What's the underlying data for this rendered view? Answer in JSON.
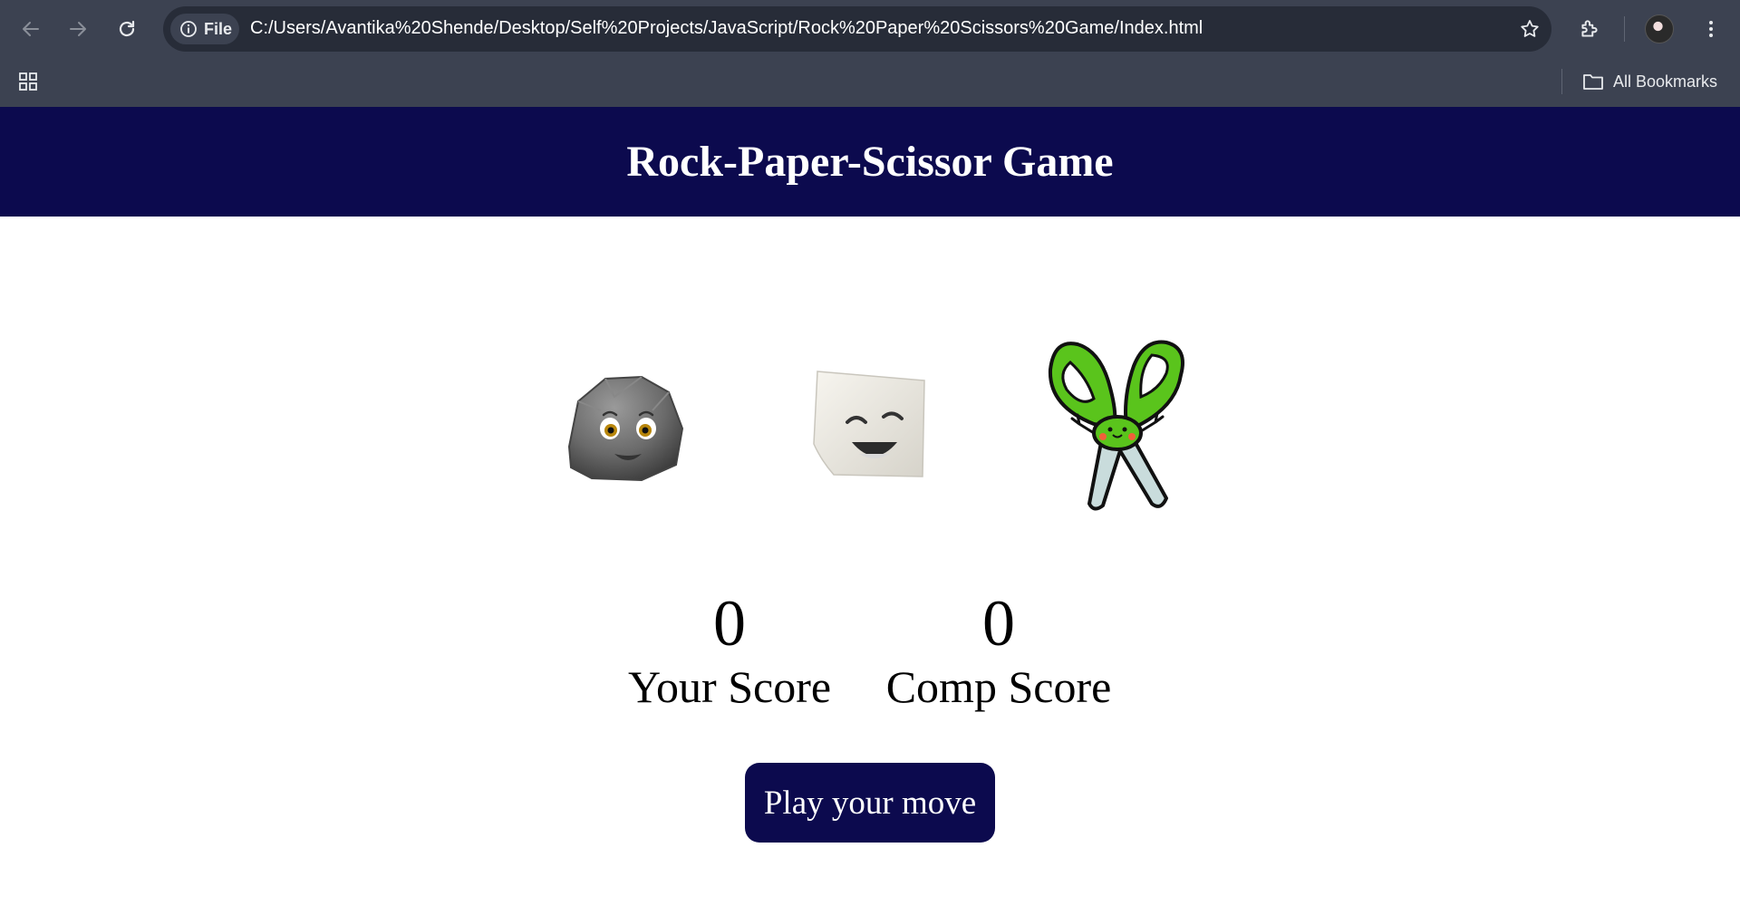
{
  "browser": {
    "site_chip": "File",
    "url": "C:/Users/Avantika%20Shende/Desktop/Self%20Projects/JavaScript/Rock%20Paper%20Scissors%20Game/Index.html",
    "bookmarks_label": "All Bookmarks",
    "chrome_color": "#3c4251",
    "omnibox_color": "#272c38"
  },
  "page": {
    "title": "Rock-Paper-Scissor Game",
    "header_color": "#0c0a4e",
    "choices": [
      {
        "id": "rock",
        "icon": "rock-face-icon"
      },
      {
        "id": "paper",
        "icon": "paper-face-icon"
      },
      {
        "id": "scissors",
        "icon": "scissors-face-icon"
      }
    ],
    "scores": {
      "user": {
        "value": "0",
        "label": "Your Score"
      },
      "comp": {
        "value": "0",
        "label": "Comp Score"
      }
    },
    "message": "Play your move"
  }
}
